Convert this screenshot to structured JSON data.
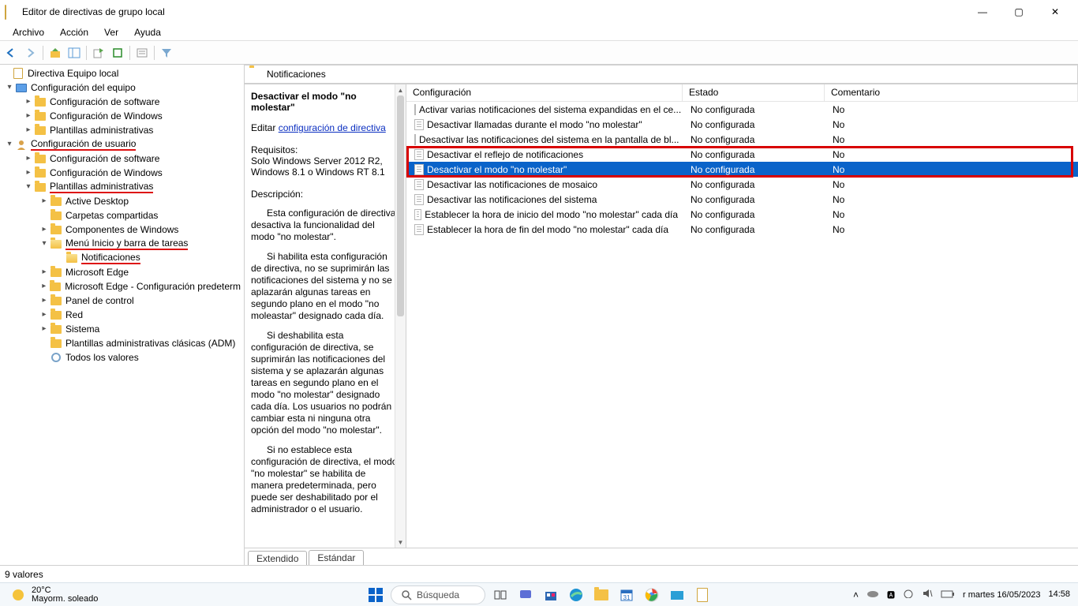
{
  "window": {
    "title": "Editor de directivas de grupo local"
  },
  "menu": [
    "Archivo",
    "Acción",
    "Ver",
    "Ayuda"
  ],
  "toolbar_icons": [
    "back",
    "forward",
    "sep",
    "up",
    "tree-toggle",
    "sep",
    "export",
    "refresh",
    "sep",
    "props",
    "sep",
    "filter"
  ],
  "tree": {
    "root": "Directiva Equipo local",
    "computer": "Configuración del equipo",
    "computer_children": [
      "Configuración de software",
      "Configuración de Windows",
      "Plantillas administrativas"
    ],
    "user": "Configuración de usuario",
    "user_children": {
      "soft": "Configuración de software",
      "win": "Configuración de Windows",
      "tmpl": "Plantillas administrativas",
      "tmpl_children": {
        "active_desktop": "Active Desktop",
        "shared": "Carpetas compartidas",
        "comp_win": "Componentes de Windows",
        "start_menu": "Menú Inicio y barra de tareas",
        "start_menu_children": {
          "notif": "Notificaciones"
        },
        "edge": "Microsoft Edge",
        "edge_def": "Microsoft Edge - Configuración predeterm",
        "panel": "Panel de control",
        "red": "Red",
        "sistema": "Sistema",
        "classic": "Plantillas administrativas clásicas (ADM)",
        "all": "Todos los valores"
      }
    }
  },
  "path_header": "Notificaciones",
  "details": {
    "title": "Desactivar el modo \"no molestar\"",
    "edit_label": "Editar",
    "edit_link": "configuración de directiva",
    "req_label": "Requisitos:",
    "req_text": "Solo Windows Server 2012 R2, Windows 8.1 o Windows RT 8.1",
    "desc_label": "Descripción:",
    "p1": "Esta configuración de directiva desactiva la funcionalidad del modo \"no molestar\".",
    "p2": "Si habilita esta configuración de directiva, no se suprimirán las notificaciones del sistema y no se aplazarán algunas tareas en segundo plano en el modo \"no moleastar\" designado cada día.",
    "p3": "Si deshabilita esta configuración de directiva, se suprimirán las notificaciones del sistema y se aplazarán algunas tareas en segundo plano en el modo \"no molestar\" designado cada día.  Los usuarios no podrán cambiar esta ni ninguna otra opción del modo \"no molestar\".",
    "p4": "Si no establece esta configuración de directiva, el modo \"no molestar\" se habilita de manera predeterminada, pero puede ser deshabilitado por el administrador o el usuario."
  },
  "columns": {
    "conf": "Configuración",
    "state": "Estado",
    "com": "Comentario"
  },
  "rows": [
    {
      "name": "Activar varias notificaciones del sistema expandidas en el ce...",
      "state": "No configurada",
      "com": "No",
      "sel": false
    },
    {
      "name": "Desactivar llamadas durante el modo \"no molestar\"",
      "state": "No configurada",
      "com": "No",
      "sel": false
    },
    {
      "name": "Desactivar las notificaciones del sistema en la pantalla de bl...",
      "state": "No configurada",
      "com": "No",
      "sel": false
    },
    {
      "name": "Desactivar el reflejo de notificaciones",
      "state": "No configurada",
      "com": "No",
      "sel": false
    },
    {
      "name": "Desactivar el modo \"no molestar\"",
      "state": "No configurada",
      "com": "No",
      "sel": true
    },
    {
      "name": "Desactivar las notificaciones de mosaico",
      "state": "No configurada",
      "com": "No",
      "sel": false
    },
    {
      "name": "Desactivar las notificaciones del sistema",
      "state": "No configurada",
      "com": "No",
      "sel": false
    },
    {
      "name": "Establecer la hora de inicio del modo \"no molestar\" cada día",
      "state": "No configurada",
      "com": "No",
      "sel": false
    },
    {
      "name": "Establecer la hora de fin del modo \"no molestar\" cada día",
      "state": "No configurada",
      "com": "No",
      "sel": false
    }
  ],
  "tabs": {
    "ext": "Extendido",
    "std": "Estándar"
  },
  "status": "9 valores",
  "taskbar": {
    "temp": "20°C",
    "weather": "Mayorm. soleado",
    "search": "Búsqueda",
    "date_line": "r   martes 16/05/2023",
    "time": "14:58"
  }
}
